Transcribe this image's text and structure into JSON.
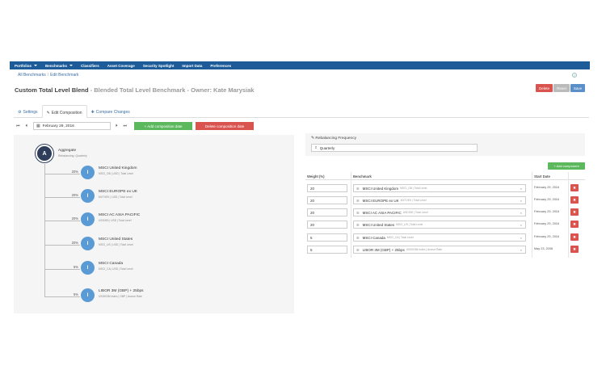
{
  "nav": {
    "items": [
      {
        "label": "Portfolios",
        "caret": true
      },
      {
        "label": "Benchmarks",
        "caret": true
      },
      {
        "label": "Classifiers",
        "caret": false
      },
      {
        "label": "Asset Coverage",
        "caret": false
      },
      {
        "label": "Security Spotlight",
        "caret": false
      },
      {
        "label": "Import Data",
        "caret": false
      },
      {
        "label": "Preferences",
        "caret": false
      }
    ],
    "color": "#1d5c99"
  },
  "breadcrumb": {
    "items": [
      "All Benchmarks",
      "Edit Benchmark"
    ],
    "separator": "/"
  },
  "page": {
    "title": "Custom Total Level Blend",
    "subtitle": "- Blended Total Level Benchmark - Owner: Kate Marysiak"
  },
  "header_buttons": {
    "delete": "Delete",
    "reset": "Reset",
    "save": "Save"
  },
  "tabs": [
    {
      "label": "Settings",
      "icon": "gear-icon",
      "active": false
    },
    {
      "label": "Edit Composition",
      "icon": "pencil-icon",
      "active": true
    },
    {
      "label": "Compare Changes",
      "icon": "compare-icon",
      "active": false
    }
  ],
  "date_nav": {
    "date": "February 29, 2016",
    "add_label": "+ Add composition date",
    "delete_label": "Delete composition date"
  },
  "tree": {
    "root": {
      "letter": "A",
      "label": "Aggregate",
      "sub": "Rebalancing: Quarterly"
    },
    "children": [
      {
        "pct": "20%",
        "letter": "I",
        "name": "MSCI United Kingdom",
        "meta": "MSCI_GB | USD | Total Level"
      },
      {
        "pct": "20%",
        "letter": "I",
        "name": "MSCI EUROPE ex UK",
        "meta": "MXTVEK | USD | Total Level"
      },
      {
        "pct": "20%",
        "letter": "I",
        "name": "MSCI AC ASIA PACIFIC",
        "meta": "USD300 | USD | Total Level"
      },
      {
        "pct": "20%",
        "letter": "I",
        "name": "MSCI United States",
        "meta": "MSCI_US | USD | Total Level"
      },
      {
        "pct": "5%",
        "letter": "I",
        "name": "MSCI Canada",
        "meta": "MSCI_CA | USD | Total Level"
      },
      {
        "pct": "5%",
        "letter": "I",
        "name": "LIBOR 3M (GBP) + 25bps",
        "meta": "US0003M Index | GBP | Accrue Rate"
      }
    ]
  },
  "rebalancing": {
    "label": "Rebalancing Frequency",
    "value": "Quarterly"
  },
  "add_component_label": "+ Add component",
  "components_table": {
    "headers": {
      "weight": "Weight (%)",
      "benchmark": "Benchmark",
      "start": "Start Date"
    },
    "rows": [
      {
        "weight": "20",
        "name": "MSCI United Kingdom",
        "meta": "MSCI_GB | Total Level",
        "start": "February 29, 2016"
      },
      {
        "weight": "20",
        "name": "MSCI EUROPE ex UK",
        "meta": "MXTVEK | Total Level",
        "start": "February 29, 2016"
      },
      {
        "weight": "20",
        "name": "MSCI AC ASIA PACIFIC",
        "meta": "USD300 | Total Level",
        "start": "February 29, 2016"
      },
      {
        "weight": "20",
        "name": "MSCI United States",
        "meta": "MSCI_US | Total Level",
        "start": "February 29, 2016"
      },
      {
        "weight": "5",
        "name": "MSCI Canada",
        "meta": "MSCI_CA | Total Level",
        "start": "February 29, 2016"
      },
      {
        "weight": "5",
        "name": "LIBOR 3M (GBP) + 25bps",
        "meta": "US0003M Index | Accrue Rate",
        "start": "May 23, 2008"
      }
    ]
  },
  "colors": {
    "accent": "#5b9bd5",
    "danger": "#d9534f",
    "success": "#5cb85c",
    "root_node": "#2e3d59"
  }
}
